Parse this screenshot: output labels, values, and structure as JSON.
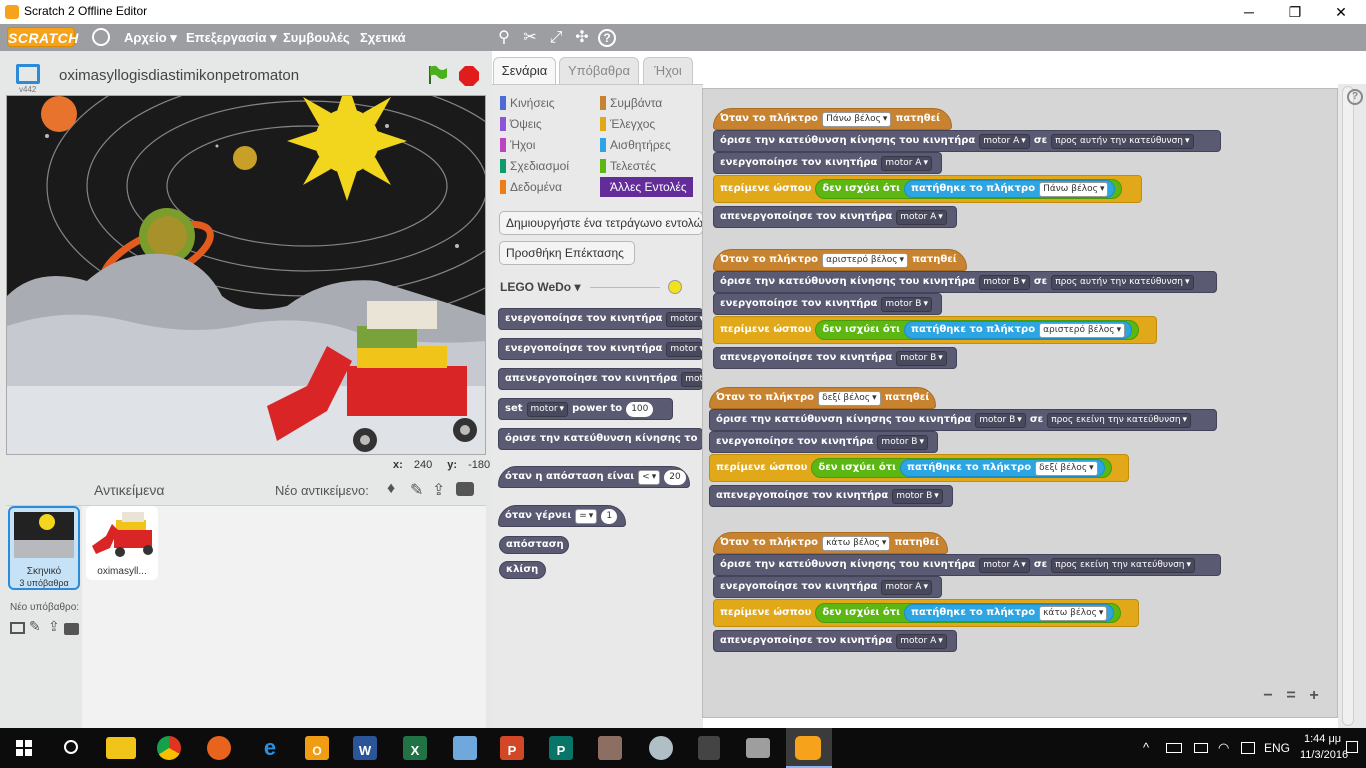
{
  "window": {
    "title": "Scratch 2 Offline Editor",
    "minimize": "─",
    "maximize": "❐",
    "close": "✕"
  },
  "menubar": {
    "logo": "SCRATCH",
    "items": [
      "Αρχείο ▾",
      "Επεξεργασία ▾",
      "Συμβουλές",
      "Σχετικά"
    ],
    "tools": [
      "duplicate",
      "delete",
      "grow",
      "shrink",
      "help"
    ]
  },
  "stage": {
    "project_title": "oximasyllogisdiastimikonpetromaton",
    "version": "v442",
    "x_label": "x:",
    "x_value": "240",
    "y_label": "y:",
    "y_value": "-180"
  },
  "sprites": {
    "header": "Αντικείμενα",
    "new_sprite": "Νέο αντικείμενο:",
    "stage_label": "Σκηνικό",
    "stage_sub": "3 υπόβαθρα",
    "new_backdrop": "Νέο υπόβαθρο:",
    "sprite_name": "oximasyll..."
  },
  "tabs": [
    "Σενάρια",
    "Υπόβαθρα",
    "Ήχοι"
  ],
  "categories": [
    {
      "label": "Κινήσεις",
      "color": "#4a6cd4"
    },
    {
      "label": "Συμβάντα",
      "color": "#c88330"
    },
    {
      "label": "Όψεις",
      "color": "#8a55d7"
    },
    {
      "label": "Έλεγχος",
      "color": "#e1a91a"
    },
    {
      "label": "Ήχοι",
      "color": "#bb42c3"
    },
    {
      "label": "Αισθητήρες",
      "color": "#2ca5e2"
    },
    {
      "label": "Σχεδιασμοί Πένας",
      "color": "#0e9a6c"
    },
    {
      "label": "Τελεστές",
      "color": "#5cb712"
    },
    {
      "label": "Δεδομένα",
      "color": "#ee7d16"
    },
    {
      "label": "Άλλες Εντολές",
      "color": "#632d99"
    }
  ],
  "palette": {
    "make_block": "Δημιουργήστε ένα τετράγωνο εντολών",
    "add_extension": "Προσθήκη Επέκτασης",
    "extension_name": "LEGO WeDo ▾",
    "blocks": {
      "on1": "ενεργοποίησε τον κινητήρα",
      "motor": "motor",
      "on2": "ενεργοποίησε τον κινητήρα",
      "off": "απενεργοποίησε τον κινητήρα",
      "mot": "mot",
      "set": "set",
      "power": "power to",
      "power_val": "100",
      "dir": "όρισε την κατεύθυνση κίνησης το",
      "dist_when": "όταν η απόσταση είναι",
      "lt": "<",
      "dist_val": "20",
      "tilt_when": "όταν γέρνει",
      "eq": "=",
      "tilt_val": "1",
      "distance": "απόσταση",
      "tilt": "κλίση"
    }
  },
  "scripts": {
    "when_key": "Όταν το πλήκτρο",
    "pressed": "πατηθεί",
    "set_dir": "όρισε την κατεύθυνση κίνησης του κινητήρα",
    "se": "σε",
    "turn_on": "ενεργοποίησε τον κινητήρα",
    "wait_until": "περίμενε ώσπου",
    "not": "δεν ισχύει ότι",
    "key_pressed": "πατήθηκε το πλήκτρο",
    "turn_off": "απενεργοποίησε τον κινητήρα",
    "groups": [
      {
        "key": "Πάνω βέλος",
        "motor": "motor A",
        "dir": "προς αυτήν την κατεύθυνση"
      },
      {
        "key": "αριστερό βέλος",
        "motor": "motor B",
        "dir": "προς αυτήν την κατεύθυνση"
      },
      {
        "key": "δεξί βέλος",
        "motor": "motor B",
        "dir": "προς εκείνη την κατεύθυνση"
      },
      {
        "key": "κάτω βέλος",
        "motor": "motor A",
        "dir": "προς εκείνη την κατεύθυνση"
      }
    ],
    "zoom": [
      "−",
      "=",
      "+"
    ]
  },
  "taskbar": {
    "lang": "ENG",
    "time": "1:44 μμ",
    "date": "11/3/2016"
  }
}
